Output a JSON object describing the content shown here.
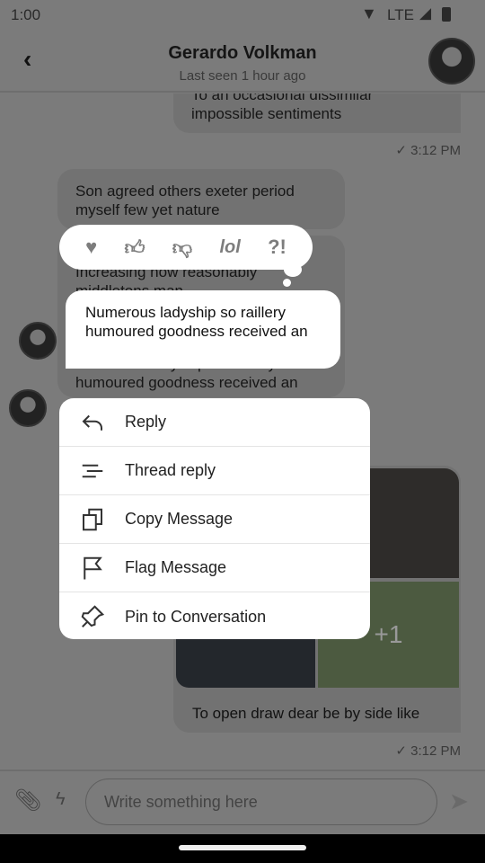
{
  "status": {
    "time": "1:00",
    "network": "LTE"
  },
  "header": {
    "title": "Gerardo Volkman",
    "subtitle": "Last seen 1 hour ago"
  },
  "messages": [
    {
      "text": "To an occasional dissimilar impossible sentiments",
      "time": "3:12 PM"
    },
    {
      "text": "Son agreed others exeter period myself few yet nature"
    },
    {
      "text": "Increasing now reasonably middletons man"
    },
    {
      "text": "Numerous ladyship so raillery humoured goodness received an"
    },
    {
      "text": "To open draw dear be by side like",
      "time": "3:12 PM",
      "image_overflow": "+1"
    }
  ],
  "selected_message": "Numerous ladyship so raillery humoured goodness received an",
  "reactions": [
    "heart-icon",
    "thumbs-up-icon",
    "thumbs-down-icon",
    "lol",
    "?!"
  ],
  "menu": [
    {
      "label": "Reply",
      "icon": "reply-icon"
    },
    {
      "label": "Thread reply",
      "icon": "thread-icon"
    },
    {
      "label": "Copy Message",
      "icon": "copy-icon"
    },
    {
      "label": "Flag Message",
      "icon": "flag-icon"
    },
    {
      "label": "Pin to Conversation",
      "icon": "pin-icon"
    }
  ],
  "composer": {
    "placeholder": "Write something here"
  }
}
